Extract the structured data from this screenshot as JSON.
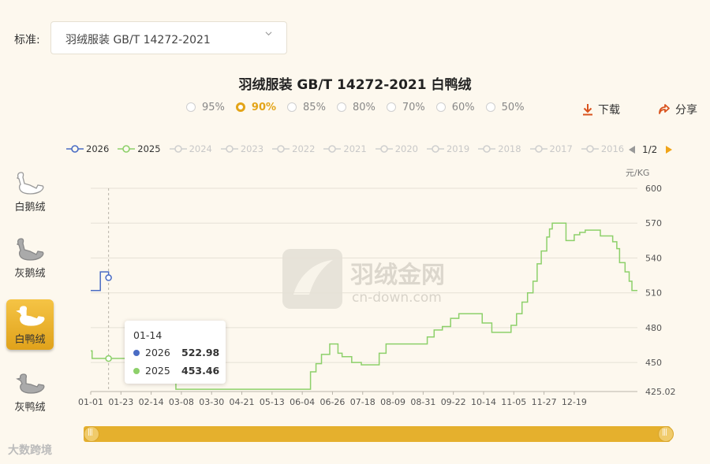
{
  "standard": {
    "label": "标准:",
    "value": "羽绒服装 GB/T 14272-2021"
  },
  "title": "羽绒服装 GB/T 14272-2021 白鸭绒",
  "percent_options": [
    "95%",
    "90%",
    "85%",
    "80%",
    "70%",
    "60%",
    "50%"
  ],
  "percent_selected": "90%",
  "actions": {
    "download": "下载",
    "share": "分享"
  },
  "years": [
    "2026",
    "2025",
    "2024",
    "2023",
    "2022",
    "2021",
    "2020",
    "2019",
    "2018",
    "2017",
    "2016"
  ],
  "years_active": [
    "2026",
    "2025"
  ],
  "pager": "1/2",
  "sidebar": [
    {
      "label": "白鹅绒",
      "active": false
    },
    {
      "label": "灰鹅绒",
      "active": false
    },
    {
      "label": "白鸭绒",
      "active": true
    },
    {
      "label": "灰鸭绒",
      "active": false
    }
  ],
  "watermark": {
    "cn": "羽绒金网",
    "en": "cn-down.com"
  },
  "brand": "大数跨境",
  "tooltip": {
    "date": "01-14",
    "rows": [
      {
        "name": "2026",
        "value": "522.98",
        "color": "#4a6cc4"
      },
      {
        "name": "2025",
        "value": "453.46",
        "color": "#8dd06a"
      }
    ]
  },
  "colors": {
    "accent": "#e3a418",
    "series_2026": "#4a6cc4",
    "series_2025": "#8dd06a"
  },
  "chart_data": {
    "type": "line",
    "ylabel": "元/KG",
    "ylim": [
      425.02,
      600
    ],
    "yticks": [
      "600",
      "570",
      "540",
      "510",
      "480",
      "450",
      "425.02"
    ],
    "yticks_values": [
      600,
      570,
      540,
      510,
      480,
      450,
      425.02
    ],
    "xticks": [
      "01-01",
      "01-23",
      "02-14",
      "03-08",
      "03-30",
      "04-21",
      "05-13",
      "06-04",
      "06-26",
      "07-18",
      "08-09",
      "08-31",
      "09-22",
      "10-14",
      "11-05",
      "11-27",
      "12-19"
    ],
    "grid": true,
    "series": [
      {
        "name": "2026",
        "step": true,
        "points": [
          [
            0,
            512
          ],
          [
            6,
            512
          ],
          [
            7,
            528
          ],
          [
            13,
            528
          ],
          [
            13,
            522.98
          ]
        ]
      },
      {
        "name": "2025",
        "step": true,
        "points": [
          [
            0,
            460
          ],
          [
            1,
            453.5
          ],
          [
            13,
            453.5
          ],
          [
            14,
            453.5
          ],
          [
            22,
            453.5
          ],
          [
            30,
            453.5
          ],
          [
            45,
            441
          ],
          [
            62,
            427
          ],
          [
            155,
            427
          ],
          [
            160,
            442
          ],
          [
            164,
            449
          ],
          [
            168,
            457
          ],
          [
            174,
            466
          ],
          [
            178,
            466
          ],
          [
            180,
            458
          ],
          [
            183,
            455
          ],
          [
            190,
            450
          ],
          [
            197,
            448
          ],
          [
            205,
            448
          ],
          [
            210,
            458
          ],
          [
            215,
            466
          ],
          [
            222,
            466
          ],
          [
            240,
            466
          ],
          [
            245,
            472
          ],
          [
            250,
            478
          ],
          [
            256,
            481
          ],
          [
            262,
            488
          ],
          [
            268,
            492
          ],
          [
            280,
            492
          ],
          [
            285,
            484
          ],
          [
            292,
            476
          ],
          [
            305,
            476
          ],
          [
            306,
            482
          ],
          [
            310,
            492
          ],
          [
            314,
            502
          ],
          [
            318,
            510
          ],
          [
            322,
            520
          ],
          [
            325,
            535
          ],
          [
            328,
            546
          ],
          [
            332,
            558
          ],
          [
            334,
            565
          ],
          [
            336,
            570
          ],
          [
            345,
            570
          ],
          [
            346,
            555
          ],
          [
            352,
            560
          ],
          [
            356,
            562
          ],
          [
            360,
            564
          ],
          [
            365,
            564
          ],
          [
            371,
            559
          ],
          [
            377,
            559
          ],
          [
            380,
            554
          ],
          [
            383,
            548
          ],
          [
            385,
            536
          ],
          [
            389,
            528
          ],
          [
            392,
            520
          ],
          [
            394,
            512
          ],
          [
            398,
            512
          ]
        ]
      }
    ]
  }
}
